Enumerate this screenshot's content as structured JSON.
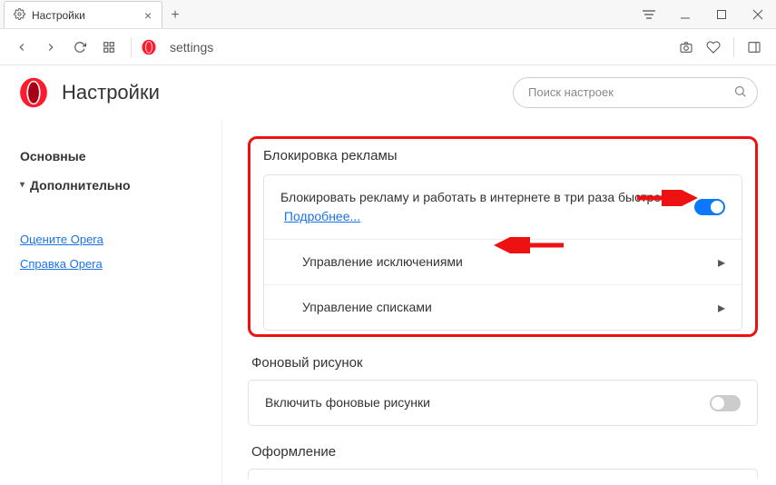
{
  "tab": {
    "title": "Настройки"
  },
  "addressbar": {
    "url": "settings"
  },
  "header": {
    "title": "Настройки",
    "search_placeholder": "Поиск настроек"
  },
  "sidebar": {
    "basic": "Основные",
    "advanced": "Дополнительно",
    "rate": "Оцените Opera",
    "help": "Справка Opera"
  },
  "adblock": {
    "section_title": "Блокировка рекламы",
    "description": "Блокировать рекламу и работать в интернете в три раза быстрее",
    "learn_more": "Подробнее...",
    "toggle_on": true,
    "manage_exceptions": "Управление исключениями",
    "manage_lists": "Управление списками"
  },
  "wallpaper": {
    "section_title": "Фоновый рисунок",
    "enable_label": "Включить фоновые рисунки",
    "toggle_on": false
  },
  "appearance": {
    "section_title": "Оформление"
  }
}
